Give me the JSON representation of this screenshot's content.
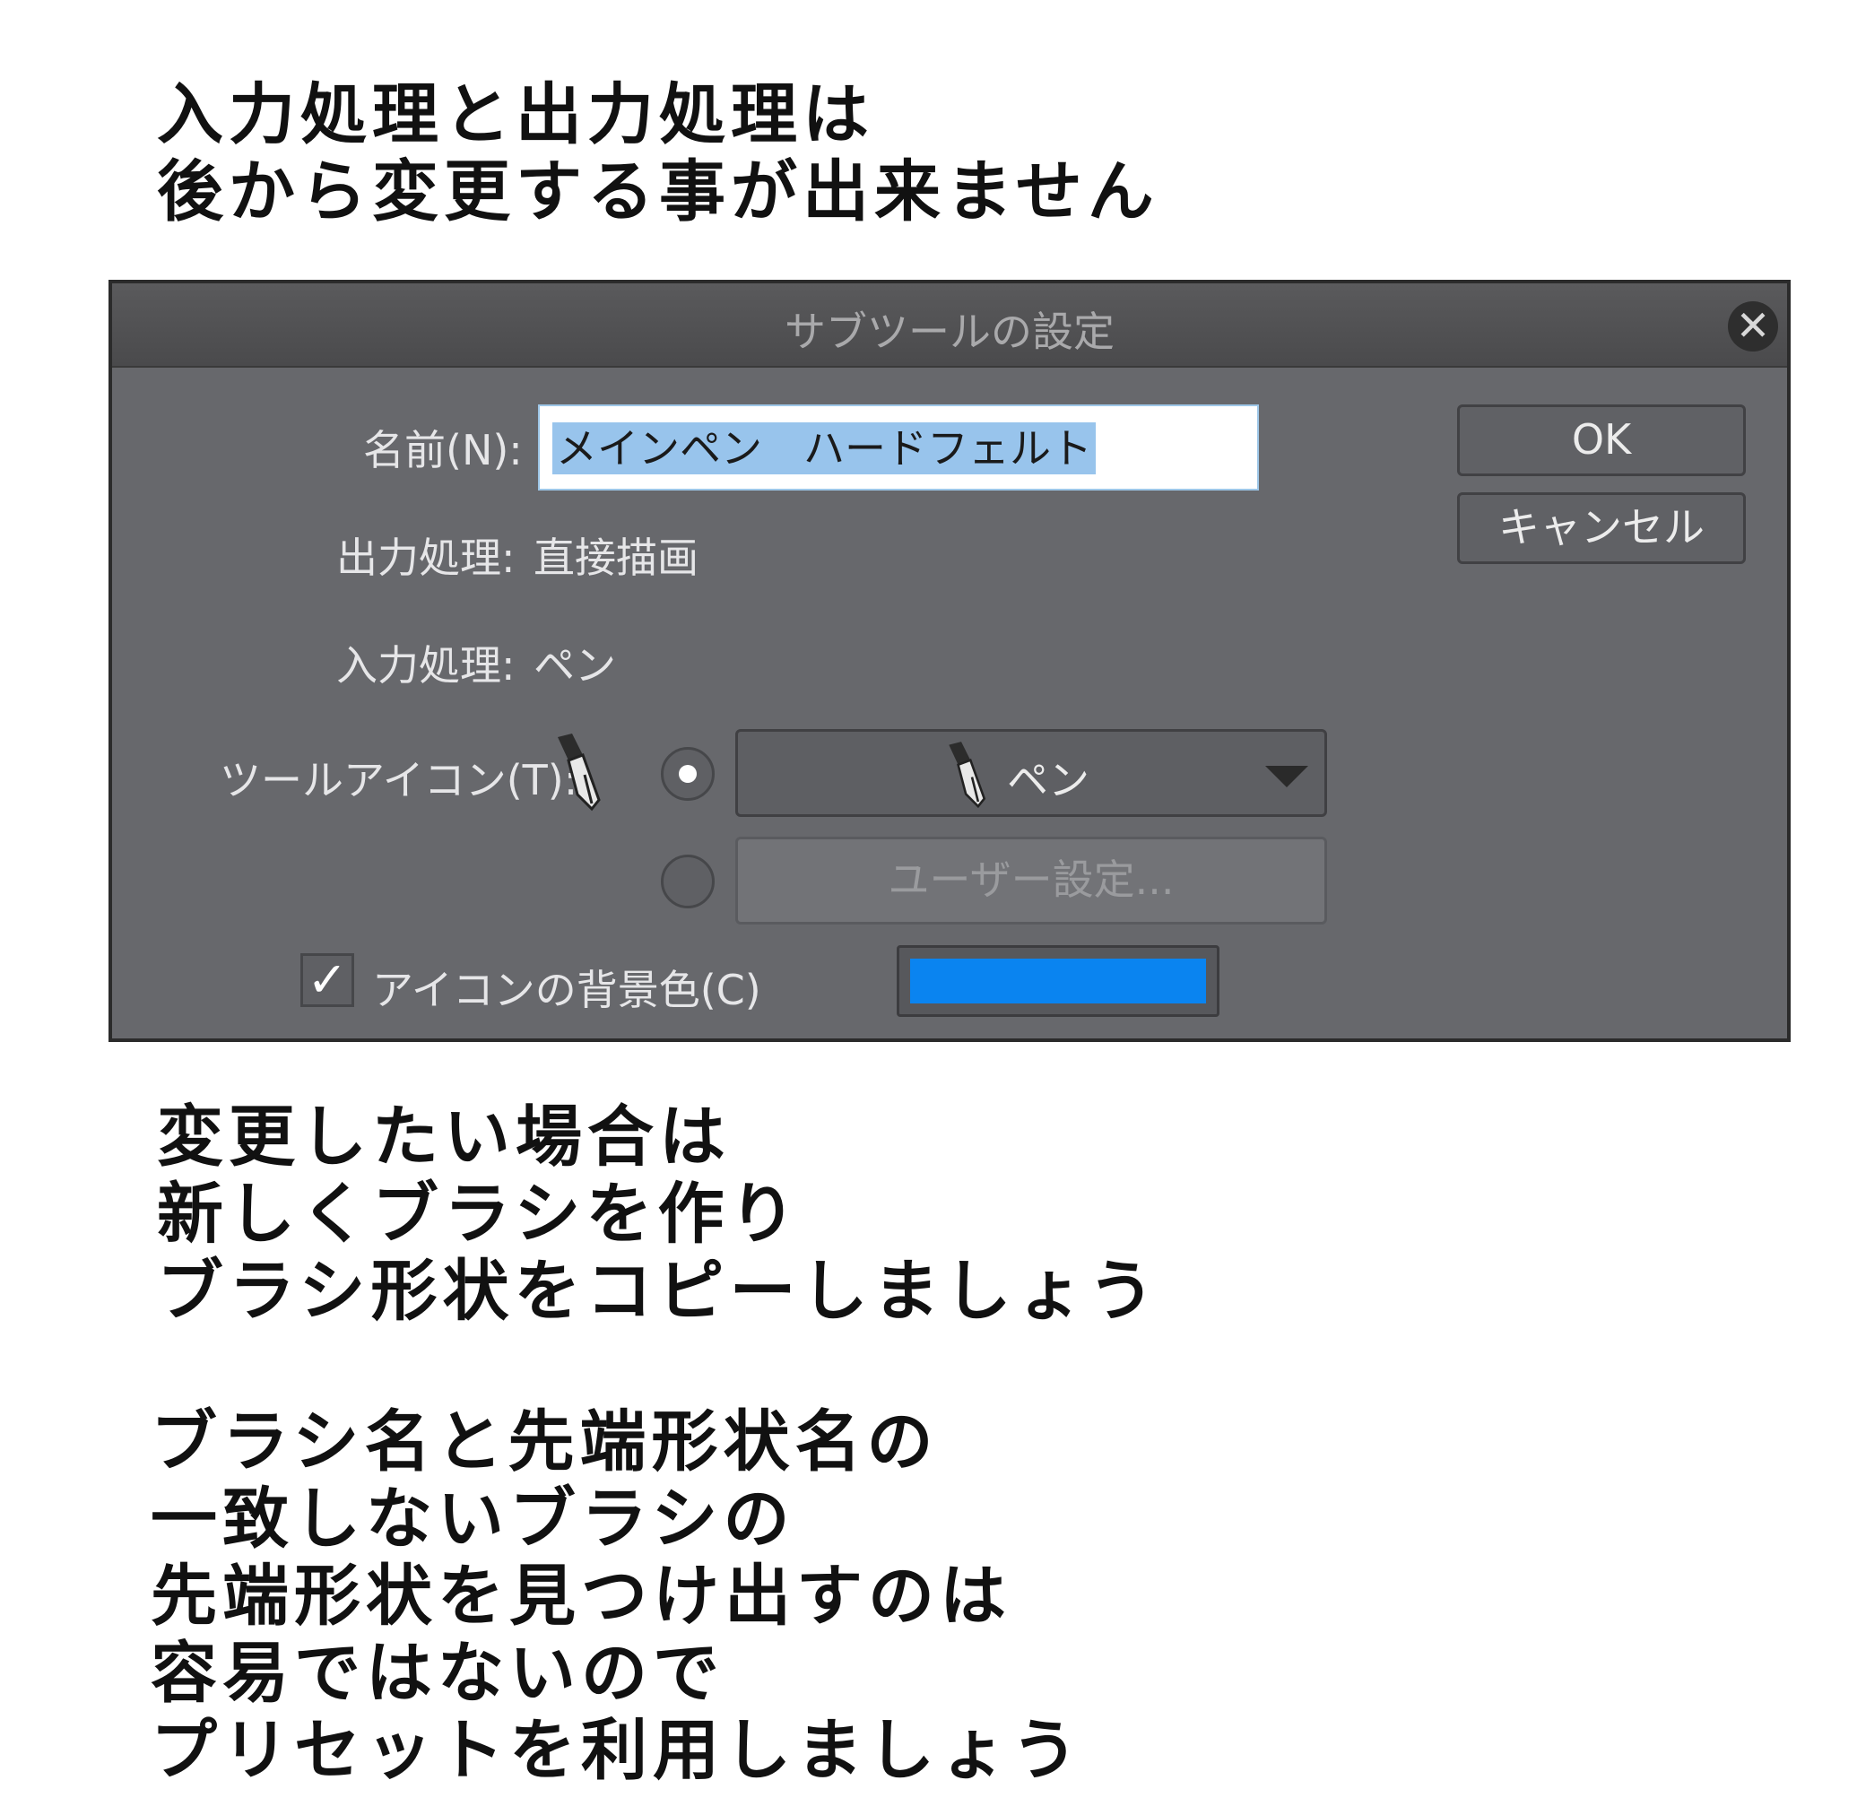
{
  "caption_top": {
    "lines": [
      "入力処理と出力処理は",
      "後から変更する事が出来ません"
    ]
  },
  "dialog": {
    "title": "サブツールの設定",
    "close_glyph": "✕",
    "name_label": "名前(N):",
    "name_value": "メインペン　ハードフェルト",
    "output_label": "出力処理:",
    "output_value": "直接描画",
    "input_label": "入力処理:",
    "input_value": "ペン",
    "tool_icon_label": "ツールアイコン(T):",
    "icon_dropdown_value": "ペン",
    "user_setting_label": "ユーザー設定...",
    "icon_bg_label": "アイコンの背景色(C)",
    "icon_bg_checked": true,
    "icon_bg_color": "#0a84f0",
    "ok_label": "OK",
    "cancel_label": "キャンセル",
    "icons": [
      "pen-nib-icon",
      "dropdown-arrow-icon",
      "close-icon",
      "checkmark-icon"
    ]
  },
  "caption_mid": {
    "lines": [
      "変更したい場合は",
      "新しくブラシを作り",
      "ブラシ形状をコピーしましょう"
    ]
  },
  "caption_bottom": {
    "lines": [
      "ブラシ名と先端形状名の",
      "一致しないブラシの",
      "先端形状を見つけ出すのは",
      "容易ではないので",
      "プリセットを利用しましょう"
    ]
  }
}
